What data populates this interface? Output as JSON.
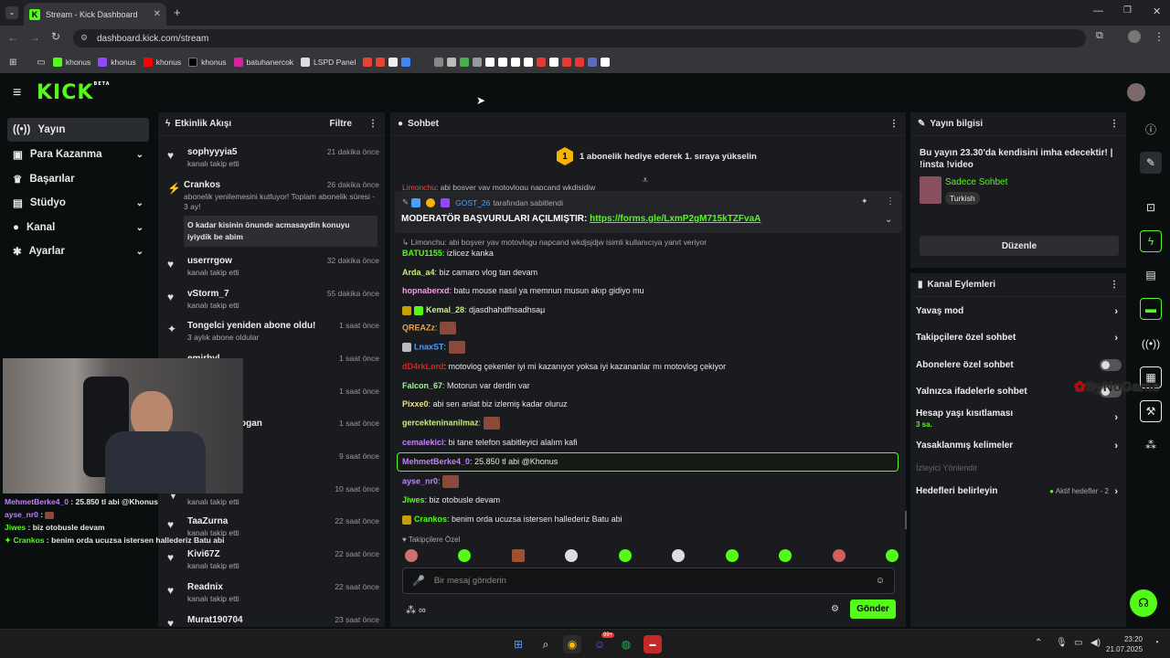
{
  "browser": {
    "tab_title": "Stream - Kick Dashboard",
    "url": "dashboard.kick.com/stream",
    "bookmarks": [
      "khonus",
      "khonus",
      "khonus",
      "khonus",
      "batuhanercok",
      "LSPD Panel"
    ]
  },
  "brand": {
    "logo": "KICK",
    "beta": "BETA",
    "accent": "#53fc18"
  },
  "nav": [
    {
      "label": "Yayın",
      "icon": "broadcast-icon"
    },
    {
      "label": "Para Kazanma",
      "icon": "wallet-icon"
    },
    {
      "label": "Başarılar",
      "icon": "trophy-icon"
    },
    {
      "label": "Stüdyo",
      "icon": "studio-icon"
    },
    {
      "label": "Kanal",
      "icon": "user-icon"
    },
    {
      "label": "Ayarlar",
      "icon": "gear-icon"
    }
  ],
  "activity": {
    "title": "Etkinlik Akışı",
    "filter": "Filtre",
    "items": [
      {
        "name": "sophyyyia5",
        "sub": "kanalı takip etti",
        "time": "21 dakika önce"
      },
      {
        "name": "Crankos",
        "sub": "abonelik yenilemesini kutluyor! Toplam abonelik süresi - 3 ay!",
        "time": "26 dakika önce",
        "quote": "O kadar kisinin önunde acmasaydin konuyu iyiydik be abim"
      },
      {
        "name": "userrrgow",
        "sub": "kanalı takip etti",
        "time": "32 dakika önce"
      },
      {
        "name": "vStorm_7",
        "sub": "kanalı takip etti",
        "time": "55 dakika önce"
      },
      {
        "name": "Tongelci yeniden abone oldu!",
        "sub": "3 aylık abone oldular",
        "time": "1 saat önce"
      },
      {
        "name": "emirbyl",
        "time": "1 saat önce"
      },
      {
        "time": "1 saat önce"
      },
      {
        "name": "ogan",
        "time": "1 saat önce"
      },
      {
        "time": "9 saat önce"
      },
      {
        "sub": "kanalı takip etti",
        "time": "10 saat önce"
      },
      {
        "name": "TaaZurna",
        "sub": "kanalı takip etti",
        "time": "22 saat önce"
      },
      {
        "name": "Kivi67Z",
        "sub": "kanalı takip etti",
        "time": "22 saat önce"
      },
      {
        "name": "Readnix",
        "sub": "kanalı takip etti",
        "time": "22 saat önce"
      },
      {
        "name": "Murat190704",
        "time": "23 saat önce"
      }
    ]
  },
  "chat": {
    "title": "Sohbet",
    "gift_banner": "1 abonelik hediye ederek 1. sıraya yükselin",
    "gift_rank": "1",
    "pinned": {
      "by": "GOST_26",
      "by_suffix": "tarafından sabitlendi",
      "text": "MODERATÖR BAŞVURULARI AÇILMIŞTIR: ",
      "link": "https://forms.gle/LxmP2gM715kTZFvaA"
    },
    "cut_line": "abi bosver yav motovlogu napcand wkdjsjdjw",
    "reply_line": "Limonchu: abi boşver yav motovlogu napcand wkdjsjdjw isimli kullanıcıya yanıt veriyor",
    "messages": [
      {
        "user": "BATU1155",
        "text": "izlicez kanka",
        "color": "#53fc18"
      },
      {
        "user": "Arda_a4",
        "text": "biz camaro vlog tan devam",
        "color": "#c6f07a"
      },
      {
        "user": "hopnaberxd",
        "text": "batu mouse nasıl ya memnun musun akıp gidiyo mu",
        "color": "#f0a0e0"
      },
      {
        "user": "Kemal_28",
        "text": "djasdhahdfhsadhsaµ",
        "color": "#c6f07a"
      },
      {
        "user": "QREAZz",
        "text": "",
        "color": "#f0a040"
      },
      {
        "user": "LnaxST",
        "text": "",
        "color": "#4aa0ff"
      },
      {
        "user": "dD4rkLord",
        "text": "motovlog çekenler iyi mi kazanıyor yoksa iyi kazananlar mı motovlog çekiyor",
        "color": "#e02020"
      },
      {
        "user": "Falcon_67",
        "text": "Motorun var derdin var",
        "color": "#a0f0a0"
      },
      {
        "user": "Pixxe0",
        "text": "abi sen anlat biz izlemiş kadar oluruz",
        "color": "#f0e080"
      },
      {
        "user": "gercekteninanilmaz",
        "text": "",
        "color": "#c6f07a"
      },
      {
        "user": "cemalekici",
        "text": "bi tane telefon sabitleyici alalım kafi",
        "color": "#c080ff"
      },
      {
        "user": "MehmetBerke4_0",
        "text": "25.850 tl abi @Khonus",
        "color": "#c080ff"
      },
      {
        "user": "ayse_nr0",
        "text": "",
        "color": "#c080ff"
      },
      {
        "user": "Jiwes",
        "text": "biz otobusle devam",
        "color": "#53fc18"
      },
      {
        "user": "Crankos",
        "text": "benim orda ucuzsa istersen hallederiz Batu abi",
        "color": "#53fc18"
      }
    ],
    "followers_only_label": "Takipçilere Özel",
    "input_placeholder": "Bir mesaj gönderin",
    "send_label": "Gönder"
  },
  "stream_info": {
    "title": "Yayın bilgisi",
    "stream_title": "Bu yayın 23.30'da kendisini imha edecektir! | !insta !video",
    "category": "Sadece Sohbet",
    "language": "Turkish",
    "edit_label": "Düzenle"
  },
  "channel_actions": {
    "title": "Kanal Eylemleri",
    "items": [
      {
        "label": "Yavaş mod",
        "type": "arrow"
      },
      {
        "label": "Takipçilere özel sohbet",
        "type": "arrow"
      },
      {
        "label": "Abonelere özel sohbet",
        "type": "toggle"
      },
      {
        "label": "Yalnızca ifadelerle sohbet",
        "type": "toggle"
      },
      {
        "label": "Hesap yaşı kısıtlaması",
        "type": "arrow",
        "sub": "3 sa."
      },
      {
        "label": "Yasaklanmış kelimeler",
        "type": "arrow"
      },
      {
        "label": "İzleyici Yönlendir",
        "type": "disabled"
      },
      {
        "label": "Hedefleri belirleyin",
        "type": "arrow",
        "badge": "Aktif hedefler - 2"
      }
    ]
  },
  "overlay_chat": [
    {
      "user": "MehmetBerke4_0",
      "text": "25.850 tl abi @Khonus",
      "color": "#c080ff"
    },
    {
      "user": "ayse_nr0",
      "text": "",
      "color": "#c080ff"
    },
    {
      "user": "Jiwes",
      "text": "biz otobusle devam",
      "color": "#53fc18"
    },
    {
      "user": "Crankos",
      "text": "benim orda ucuzsa istersen hallederiz Batu abi",
      "color": "#53fc18"
    }
  ],
  "watermark": "ByNoGame",
  "taskbar": {
    "time": "23:20",
    "date": "21.07.2025",
    "badge": "99+"
  }
}
